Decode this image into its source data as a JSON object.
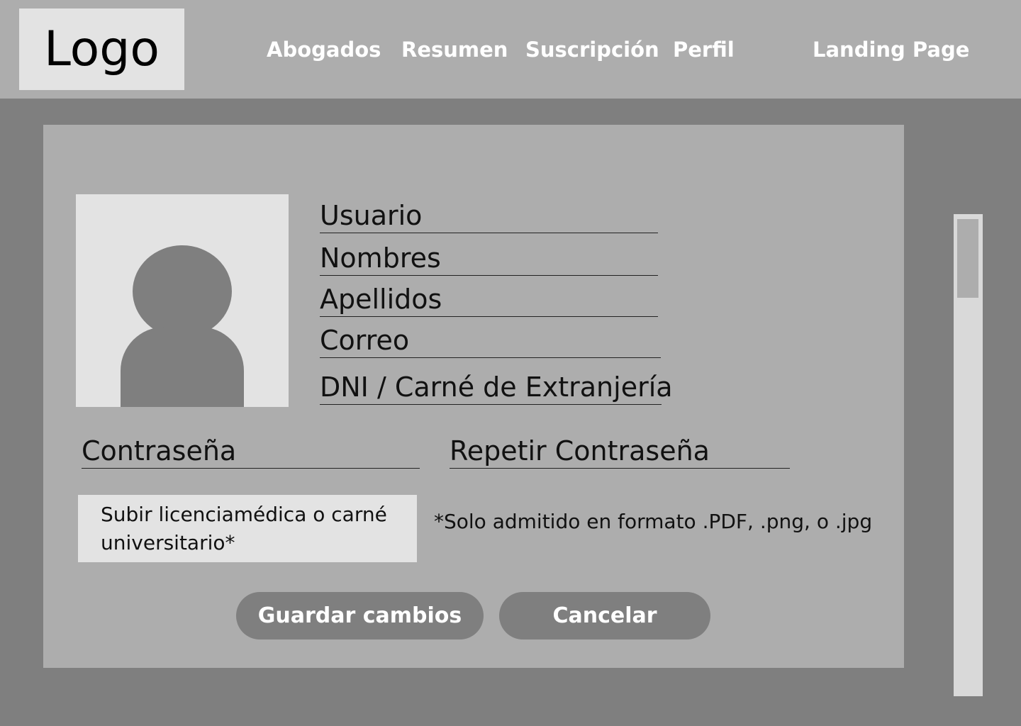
{
  "header": {
    "logo": "Logo",
    "nav": [
      "Abogados",
      "Resumen",
      "Suscripción",
      "Perfil",
      "Landing Page"
    ]
  },
  "profile": {
    "fields": {
      "usuario": "Usuario",
      "nombres": "Nombres",
      "apellidos": "Apellidos",
      "correo": "Correo",
      "dni": "DNI / Carné de Extranjería",
      "password": "Contraseña",
      "repeat_password": "Repetir Contraseña"
    },
    "upload_label": "Subir licenciamédica o carné universitario*",
    "upload_note": "*Solo admitido en formato .PDF, .png, o .jpg",
    "save_button": "Guardar cambios",
    "cancel_button": "Cancelar"
  },
  "colors": {
    "background": "#7f7f7f",
    "header": "#adadad",
    "card": "#adadad",
    "light_panel": "#e3e3e3",
    "button": "#7f7f7f"
  }
}
